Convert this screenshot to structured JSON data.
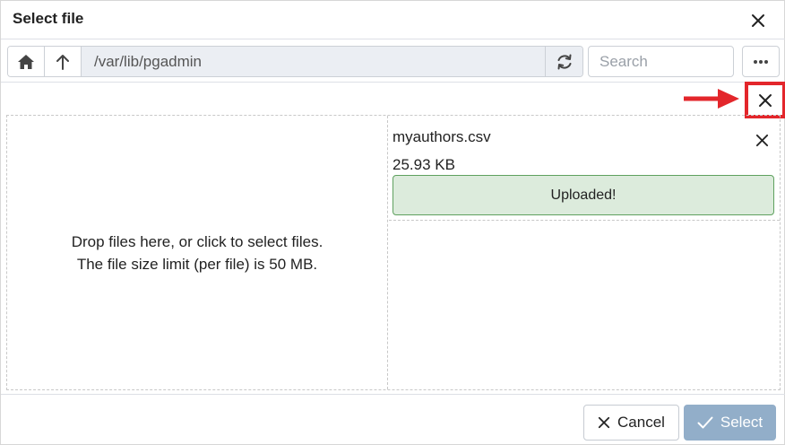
{
  "dialog": {
    "title": "Select file"
  },
  "toolbar": {
    "home_icon": "home-icon",
    "up_icon": "arrow-up-icon",
    "path": "/var/lib/pgadmin",
    "refresh_icon": "refresh-icon",
    "search_placeholder": "Search",
    "more_icon": "ellipsis-icon"
  },
  "dropzone": {
    "line1": "Drop files here, or click to select files.",
    "line2": "The file size limit (per file) is 50 MB."
  },
  "files": [
    {
      "name": "myauthors.csv",
      "size": "25.93 KB",
      "status": "Uploaded!"
    }
  ],
  "footer": {
    "cancel_label": "Cancel",
    "select_label": "Select"
  },
  "colors": {
    "highlight_annotation": "#e3262b",
    "success_bg": "#dcebdc",
    "success_border": "#5fa15f",
    "select_disabled": "#92aec9",
    "path_bg": "#ebeef3"
  }
}
